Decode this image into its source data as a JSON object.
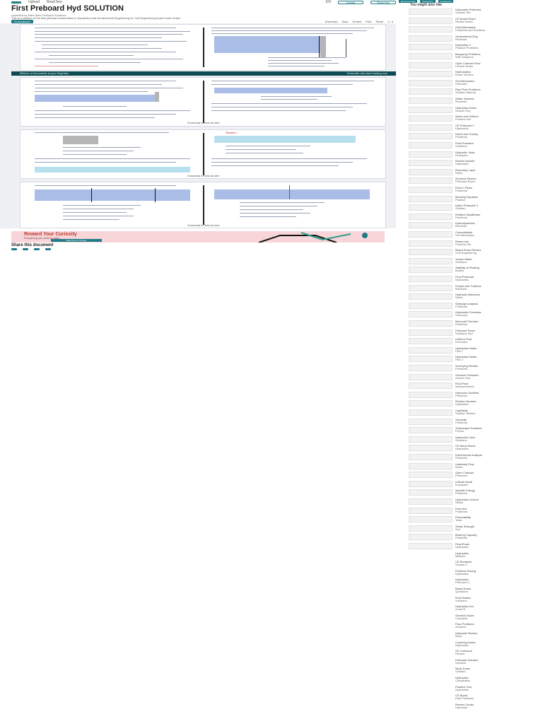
{
  "nav": {
    "logo": "scribd",
    "links": [
      "Upload",
      "Read free"
    ],
    "search": "Search",
    "right": [
      "EN",
      "Upload",
      "Read free"
    ]
  },
  "document": {
    "title": "First Preboard Hyd SOLUTION",
    "meta": "Uploaded by Mark Allen     Preboard Solutions",
    "description": "This is a solution of the first preboard examination in Hydraulics and Geotechnical Engineering for Civil Engineering board exam review.",
    "toolbar": {
      "tag": "AI-enhanced",
      "items": [
        "Download",
        "Save",
        "Embed",
        "Print",
        "Share"
      ],
      "page": "1 / 4"
    }
  },
  "viewer": {
    "read_more": [
      "Download to read ad-free",
      "Download to read ad-free",
      "Download to read ad-free"
    ],
    "banner": {
      "left": "Millions of documents at your fingertips",
      "right": "Subscribe and start reading now"
    }
  },
  "promo": {
    "headline": "Reward Your Curiosity",
    "sub": "Everything you want to read.",
    "button": "Read free for 30 days"
  },
  "share": {
    "title": "Share this document",
    "icons": [
      "facebook-icon",
      "twitter-icon",
      "linkedin-icon",
      "mail-icon"
    ]
  },
  "sidebar": {
    "tabs": [
      "Recommended",
      "Documents",
      "Audiobooks"
    ],
    "title": "You might also like",
    "items": [
      {
        "t1": "Hydraulics Preboard",
        "t2": "Solution Set",
        "thumb": true
      },
      {
        "t1": "CE Board Exam",
        "t2": "Review Notes",
        "thumb": true
      },
      {
        "t1": "Fluid Mechanics",
        "t2": "Problems and Solutions",
        "thumb": true
      },
      {
        "t1": "Geotechnical Eng",
        "t2": "Reviewer",
        "thumb": true
      },
      {
        "t1": "Hydraulics 2",
        "t2": "Practice Problems",
        "thumb": true
      },
      {
        "t1": "Buoyancy Problems",
        "t2": "With Solutions",
        "thumb": true
      },
      {
        "t1": "Open Channel Flow",
        "t2": "Lecture Notes",
        "thumb": true
      },
      {
        "t1": "Hydrostatics",
        "t2": "Exam Solution",
        "thumb": true
      },
      {
        "t1": "Soil Mechanics",
        "t2": "Preboard",
        "thumb": true
      },
      {
        "t1": "Pipe Flow Problems",
        "t2": "Solution Manual",
        "thumb": true
      },
      {
        "t1": "Water Hammer",
        "t2": "Reviewer",
        "thumb": true
      },
      {
        "t1": "Hydraulics Exam",
        "t2": "Answer Key",
        "thumb": true
      },
      {
        "t1": "Weirs and Orifices",
        "t2": "Problem Set",
        "thumb": true
      },
      {
        "t1": "CE Preboard 2",
        "t2": "Hydraulics",
        "thumb": true
      },
      {
        "t1": "Dams and Gravity",
        "t2": "Problems",
        "thumb": true
      },
      {
        "t1": "Fluid Pressure",
        "t2": "Solutions",
        "thumb": true
      },
      {
        "t1": "Hydraulic Jump",
        "t2": "Examples",
        "thumb": true
      },
      {
        "t1": "Review Module",
        "t2": "Hydraulics",
        "thumb": true
      },
      {
        "t1": "Boundary Layer",
        "t2": "Notes",
        "thumb": true
      },
      {
        "t1": "Geotech Review",
        "t2": "Preboard Exam",
        "thumb": true
      },
      {
        "t1": "Flow in Pipes",
        "t2": "Problems",
        "thumb": true
      },
      {
        "t1": "Manning Equation",
        "t2": "Practice",
        "thumb": true
      },
      {
        "t1": "Hydro Preboard 3",
        "t2": "Solution",
        "thumb": true
      },
      {
        "t1": "Relative Equilibrium",
        "t2": "Problems",
        "thumb": true
      },
      {
        "t1": "Hydrodynamics",
        "t2": "Reviewer",
        "thumb": true
      },
      {
        "t1": "Consolidation",
        "t2": "Soil Mechanics",
        "thumb": true
      },
      {
        "t1": "Reservoirs",
        "t2": "Problem Set",
        "thumb": true
      },
      {
        "t1": "Board Exam Review",
        "t2": "Civil Engineering",
        "thumb": true
      },
      {
        "t1": "Venturi Meter",
        "t2": "Solutions",
        "thumb": true
      },
      {
        "t1": "Stability of Floating",
        "t2": "Bodies",
        "thumb": true
      },
      {
        "t1": "Final Preboard",
        "t2": "Hydraulics",
        "thumb": true
      },
      {
        "t1": "Pumps and Turbines",
        "t2": "Reviewer",
        "thumb": true
      },
      {
        "t1": "Hydraulic Machines",
        "t2": "Notes",
        "thumb": true
      },
      {
        "t1": "Seepage Analysis",
        "t2": "Problems",
        "thumb": true
      },
      {
        "t1": "Hydraulics Formulas",
        "t2": "Summary",
        "thumb": true
      },
      {
        "t1": "Bernoulli Theorem",
        "t2": "Problems",
        "thumb": true
      },
      {
        "t1": "Preboard Exam",
        "t2": "Solutions Hyd",
        "thumb": true
      },
      {
        "t1": "Uniform Flow",
        "t2": "Exercises",
        "thumb": true
      },
      {
        "t1": "Hydraulics Notes",
        "t2": "Part 1",
        "thumb": true
      },
      {
        "t1": "Hydraulics Notes",
        "t2": "Part 2",
        "thumb": true
      },
      {
        "t1": "Surveying Review",
        "t2": "Problems",
        "thumb": true
      },
      {
        "t1": "Geotech Preboard",
        "t2": "Answer Key",
        "thumb": true
      },
      {
        "t1": "Fluid Flow",
        "t2": "Measurements",
        "thumb": true
      },
      {
        "t1": "Hydraulic Gradient",
        "t2": "Problems",
        "thumb": true
      },
      {
        "t1": "Review Handout",
        "t2": "Hydraulics",
        "thumb": true
      },
      {
        "t1": "Capillarity",
        "t2": "Surface Tension",
        "thumb": true
      },
      {
        "t1": "Viscosity",
        "t2": "Problems",
        "thumb": true
      },
      {
        "t1": "Submerged Surfaces",
        "t2": "Forces",
        "thumb": true
      },
      {
        "t1": "Hydraulics Quiz",
        "t2": "Solutions",
        "thumb": true
      },
      {
        "t1": "CE Mock Board",
        "t2": "Hydraulics",
        "thumb": true
      },
      {
        "t1": "Dimensional Analysis",
        "t2": "Problems",
        "thumb": true
      },
      {
        "t1": "Unsteady Flow",
        "t2": "Notes",
        "thumb": true
      },
      {
        "t1": "Open Channel",
        "t2": "Problems",
        "thumb": true
      },
      {
        "t1": "Critical Depth",
        "t2": "Examples",
        "thumb": true
      },
      {
        "t1": "Specific Energy",
        "t2": "Problems",
        "thumb": true
      },
      {
        "t1": "Hydraulics Lecture",
        "t2": "Slides",
        "thumb": true
      },
      {
        "t1": "Flow Net",
        "t2": "Problems",
        "thumb": true
      },
      {
        "t1": "Permeability",
        "t2": "Tests",
        "thumb": true
      },
      {
        "t1": "Shear Strength",
        "t2": "Soil",
        "thumb": true
      },
      {
        "t1": "Bearing Capacity",
        "t2": "Problems",
        "thumb": true
      },
      {
        "t1": "Final Exam",
        "t2": "Hydraulics",
        "thumb": true
      },
      {
        "t1": "Hydraulics",
        "t2": "Midterm",
        "thumb": false
      },
      {
        "t1": "CE Reviewer",
        "t2": "Volume 2",
        "thumb": false
      },
      {
        "t1": "Problem Solving",
        "t2": "Hydraulics",
        "thumb": false
      },
      {
        "t1": "Hydraulics",
        "t2": "Preboard 4",
        "thumb": false
      },
      {
        "t1": "Board Exam",
        "t2": "Questions",
        "thumb": false
      },
      {
        "t1": "Fluid Statics",
        "t2": "Solutions",
        "thumb": false
      },
      {
        "t1": "Hydraulics Set",
        "t2": "A and B",
        "thumb": false
      },
      {
        "t1": "Geotech Notes",
        "t2": "Complete",
        "thumb": false
      },
      {
        "t1": "Flow Problems",
        "t2": "Answers",
        "thumb": false
      },
      {
        "t1": "Hydraulic Review",
        "t2": "Book",
        "thumb": false
      },
      {
        "t1": "Coaching Notes",
        "t2": "Hydraulics",
        "thumb": false
      },
      {
        "t1": "CE Licensure",
        "t2": "Review",
        "thumb": false
      },
      {
        "t1": "Preboard Solution",
        "t2": "Geotech",
        "thumb": false
      },
      {
        "t1": "Mock Exam",
        "t2": "Solution",
        "thumb": false
      },
      {
        "t1": "Hydraulics",
        "t2": "Compilation",
        "thumb": false
      },
      {
        "t1": "Practice Test",
        "t2": "Hydraulics",
        "thumb": false
      },
      {
        "t1": "CE Board",
        "t2": "Past Problems",
        "thumb": false
      },
      {
        "t1": "Review Center",
        "t2": "Handouts",
        "thumb": false
      }
    ]
  }
}
